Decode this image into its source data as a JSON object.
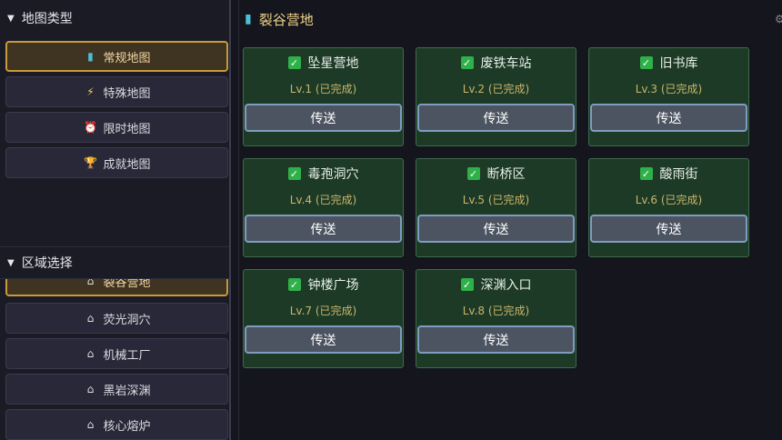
{
  "map_types": {
    "header": "地图类型",
    "items": [
      {
        "label": "常规地图",
        "icon": "book-icon",
        "active": true
      },
      {
        "label": "特殊地图",
        "icon": "lightning-icon",
        "active": false
      },
      {
        "label": "限时地图",
        "icon": "alarm-clock-icon",
        "active": false
      },
      {
        "label": "成就地图",
        "icon": "trophy-icon",
        "active": false
      }
    ]
  },
  "regions": {
    "header": "区域选择",
    "items": [
      {
        "label": "裂谷营地",
        "icon": "house-icon",
        "active": true
      },
      {
        "label": "荧光洞穴",
        "icon": "house-icon",
        "active": false
      },
      {
        "label": "机械工厂",
        "icon": "house-icon",
        "active": false
      },
      {
        "label": "黑岩深渊",
        "icon": "house-icon",
        "active": false
      },
      {
        "label": "核心熔炉",
        "icon": "house-icon",
        "active": false
      }
    ]
  },
  "main": {
    "title": "裂谷营地",
    "teleport_label": "传送",
    "stages": [
      {
        "name": "坠星营地",
        "level": "Lv.1 (已完成)"
      },
      {
        "name": "废铁车站",
        "level": "Lv.2 (已完成)"
      },
      {
        "name": "旧书库",
        "level": "Lv.3 (已完成)"
      },
      {
        "name": "毒孢洞穴",
        "level": "Lv.4 (已完成)"
      },
      {
        "name": "断桥区",
        "level": "Lv.5 (已完成)"
      },
      {
        "name": "酸雨街",
        "level": "Lv.6 (已完成)"
      },
      {
        "name": "钟楼广场",
        "level": "Lv.7 (已完成)"
      },
      {
        "name": "深渊入口",
        "level": "Lv.8 (已完成)"
      }
    ]
  },
  "colors": {
    "active_border": "#c99a3c",
    "card_bg": "#1d3a26",
    "check_green": "#2fb14a",
    "level_text": "#c9b56b"
  }
}
